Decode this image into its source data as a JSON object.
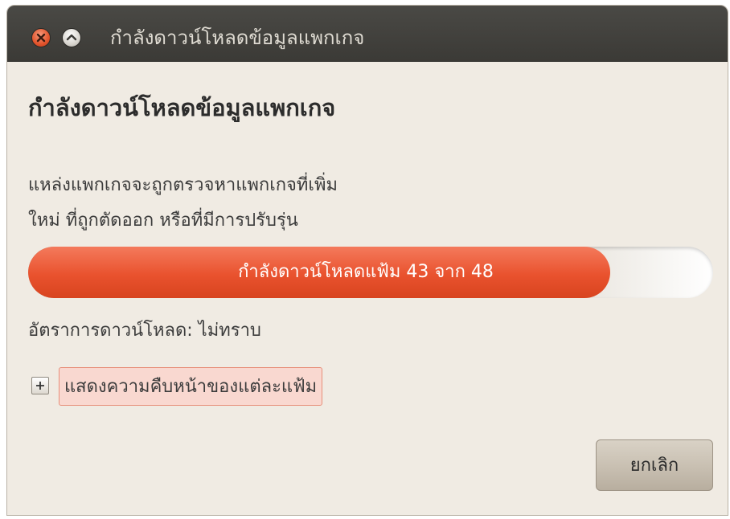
{
  "window": {
    "title": "กำลังดาวน์โหลดข้อมูลแพกเกจ"
  },
  "dialog": {
    "heading": "กำลังดาวน์โหลดข้อมูลแพกเกจ",
    "description_line1": "แหล่งแพกเกจจะถูกตรวจหาแพกเกจที่เพิ่ม",
    "description_line2": "ใหม่ ที่ถูกตัดออก หรือที่มีการปรับรุ่น",
    "progress": {
      "text": "กำลังดาวน์โหลดแฟ้ม 43 จาก 48",
      "fraction": 0.85
    },
    "rate_text": "อัตราการดาวน์โหลด: ไม่ทราบ",
    "expander_label": "แสดงความคืบหน้าของแต่ละแฟ้ม",
    "cancel_label": "ยกเลิก"
  },
  "colors": {
    "titlebar": "#3b3a36",
    "window_bg": "#f0ebe3",
    "accent": "#e9522e",
    "expander_highlight": "#f9d8d0"
  },
  "icons": {
    "close": "close-icon",
    "maximize": "maximize-icon",
    "expander": "plus-icon"
  }
}
